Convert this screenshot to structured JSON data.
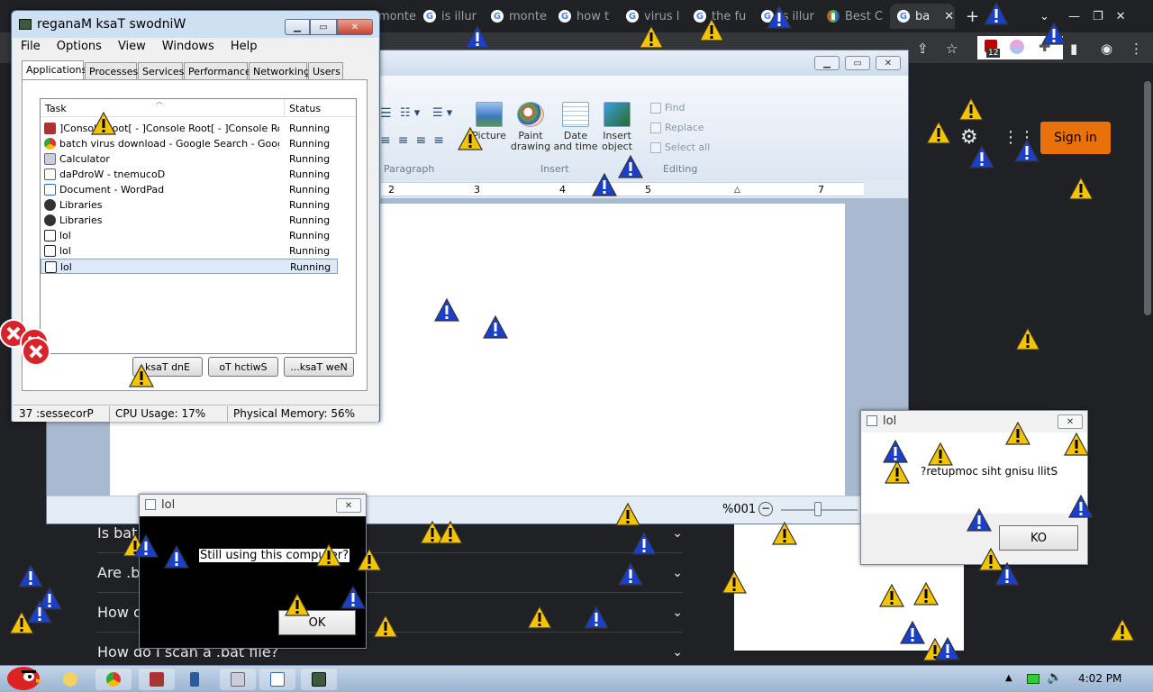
{
  "chrome": {
    "tabs": [
      {
        "label": "monte"
      },
      {
        "label": "is illur"
      },
      {
        "label": "monte"
      },
      {
        "label": "how t"
      },
      {
        "label": "virus l"
      },
      {
        "label": "the fu"
      },
      {
        "label": "is illur"
      },
      {
        "label": "Best C"
      },
      {
        "label": "ba"
      }
    ],
    "new_tab": "+",
    "sign_in": "Sign in",
    "extension_badge": "12",
    "faq": [
      {
        "label": "Is bat"
      },
      {
        "label": "Are .ba"
      },
      {
        "label": "How c"
      },
      {
        "label": "How do I scan a .bat file?"
      }
    ]
  },
  "wordpad": {
    "ribbon": {
      "buttons": [
        "Picture",
        "Paint drawing",
        "Date and time",
        "Insert object"
      ],
      "editing": [
        "Find",
        "Replace",
        "Select all"
      ],
      "groups": [
        "Paragraph",
        "Insert",
        "Editing"
      ]
    },
    "ruler": [
      "2",
      "3",
      "4",
      "5",
      "7"
    ],
    "zoom": "%001"
  },
  "taskmgr": {
    "title": "reganaM ksaT swodniW",
    "menu": [
      "File",
      "Options",
      "View",
      "Windows",
      "Help"
    ],
    "tabs": [
      "Applications",
      "Processes",
      "Services",
      "Performance",
      "Networking",
      "Users"
    ],
    "columns": {
      "task": "Task",
      "status": "Status"
    },
    "rows": [
      {
        "task": "]Console Root[ - ]Console Root[ - ]Console Root...",
        "status": "Running",
        "icon": "console-icon"
      },
      {
        "task": "batch virus download - Google Search - Google ...",
        "status": "Running",
        "icon": "chrome-icon"
      },
      {
        "task": "Calculator",
        "status": "Running",
        "icon": "calculator-icon"
      },
      {
        "task": "daPdroW - tnemucoD",
        "status": "Running",
        "icon": "wordpad-icon"
      },
      {
        "task": "Document - WordPad",
        "status": "Running",
        "icon": "wordpad-icon"
      },
      {
        "task": "Libraries",
        "status": "Running",
        "icon": "folder-icon"
      },
      {
        "task": "Libraries",
        "status": "Running",
        "icon": "folder-icon"
      },
      {
        "task": "lol",
        "status": "Running",
        "icon": "window-icon"
      },
      {
        "task": "lol",
        "status": "Running",
        "icon": "window-icon"
      },
      {
        "task": "lol",
        "status": "Running",
        "icon": "window-icon"
      }
    ],
    "buttons": [
      "ksaT dnE",
      "oT hctiwS",
      "...ksaT weN"
    ],
    "status": {
      "processes": "37 :sessecorP",
      "cpu": "CPU Usage: 17%",
      "memory": "Physical Memory: 56%"
    }
  },
  "dialog_left": {
    "title": "lol",
    "message": "Still using this computer?",
    "ok": "OK"
  },
  "dialog_right": {
    "title": "lol",
    "message": "?retupmoc siht gnisu llitS",
    "ok": "KO"
  },
  "taskbar": {
    "time": "4:02 PM"
  },
  "colors": {
    "warning_yellow": "#f5c400",
    "info_blue": "#1a3fc8",
    "signin_orange": "#e8710a"
  }
}
